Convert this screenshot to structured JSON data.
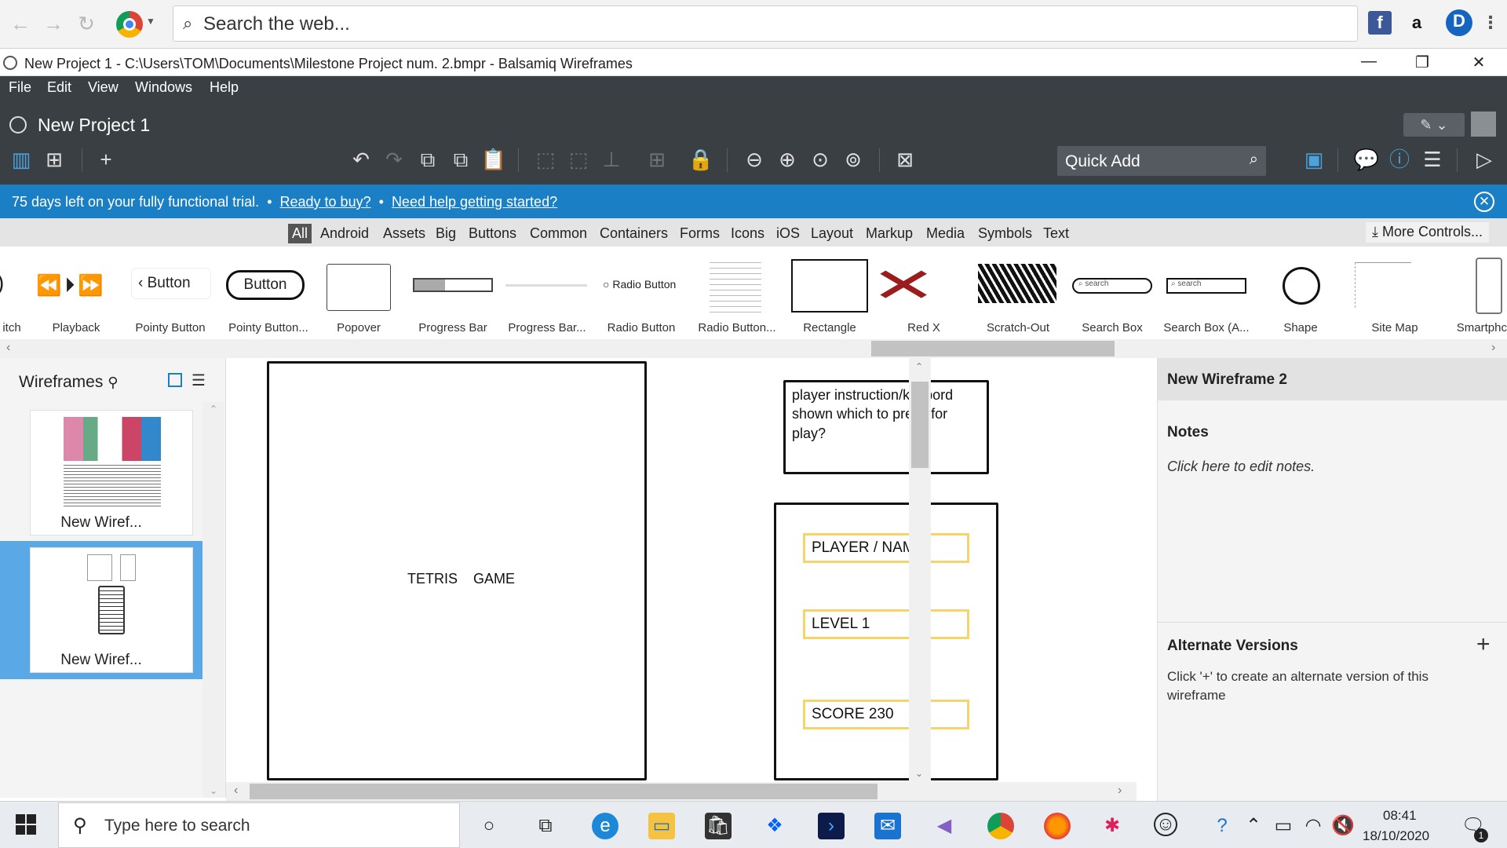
{
  "browser": {
    "url_placeholder": "Search the web...",
    "ext_facebook": "f",
    "ext_amazon": "a",
    "ext_ddg": "D",
    "menu_dots": "⋮"
  },
  "window": {
    "title": "New Project 1 - C:\\Users\\TOM\\Documents\\Milestone Project num. 2.bmpr - Balsamiq Wireframes",
    "minimize": "—",
    "restore": "❐",
    "close": "✕"
  },
  "menubar": [
    "File",
    "Edit",
    "View",
    "Windows",
    "Help"
  ],
  "project": {
    "title": "New Project 1"
  },
  "toolbar": {
    "quick_add": "Quick Add"
  },
  "trial": {
    "message": "75 days left on your fully functional trial.",
    "sep": "•",
    "link_buy": "Ready to buy?",
    "link_help": "Need help getting started?",
    "close": "✕"
  },
  "library": {
    "tabs": [
      "All",
      "Android",
      "Assets",
      "Big",
      "Buttons",
      "Common",
      "Containers",
      "Forms",
      "Icons",
      "iOS",
      "Layout",
      "Markup",
      "Media",
      "Symbols",
      "Text"
    ],
    "active_tab": "All",
    "more_controls": "More Controls...",
    "items": [
      "itch",
      "Playback",
      "Pointy Button",
      "Pointy Button...",
      "Popover",
      "Progress Bar",
      "Progress Bar...",
      "Radio Button",
      "Radio Button...",
      "Rectangle",
      "Red X",
      "Scratch-Out",
      "Search Box",
      "Search Box (A...",
      "Shape",
      "Site Map",
      "Smartphc"
    ],
    "button_text": "Button",
    "radio_text": "Radio Button",
    "search_text": "search"
  },
  "left_panel": {
    "title": "Wireframes",
    "thumbnails": [
      {
        "label": "New Wiref..."
      },
      {
        "label": "New Wiref..."
      }
    ]
  },
  "canvas": {
    "game_label": "TETRIS    GAME",
    "instructions": "player instruction/keybord shown which to press for play?",
    "field_player": "PLAYER / NAME",
    "field_level": "LEVEL 1",
    "field_score": "SCORE 230"
  },
  "right_panel": {
    "title": "New Wireframe 2",
    "notes_heading": "Notes",
    "notes_placeholder": "Click here to edit notes.",
    "alt_heading": "Alternate Versions",
    "alt_text": "Click '+' to create an alternate version of this wireframe",
    "alt_plus": "+"
  },
  "taskbar": {
    "search_placeholder": "Type here to search",
    "time": "08:41",
    "date": "18/10/2020",
    "notification_count": "1"
  },
  "colors": {
    "app_dark": "#3a3f44",
    "trial_blue": "#1a7fc4",
    "selection_blue": "#5aa8e6",
    "field_yellow": "#f5d56a"
  }
}
